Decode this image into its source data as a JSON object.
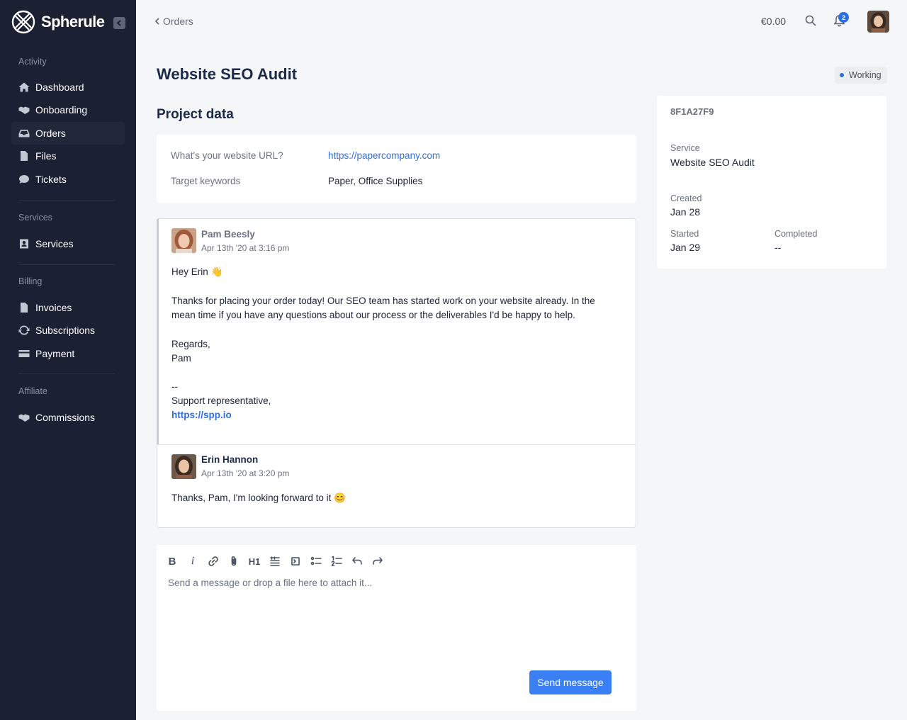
{
  "brand": {
    "name": "Spherule"
  },
  "sidebar": {
    "sections": [
      {
        "title": "Activity",
        "items": [
          {
            "label": "Dashboard",
            "icon": "home-icon"
          },
          {
            "label": "Onboarding",
            "icon": "handshake-icon"
          },
          {
            "label": "Orders",
            "icon": "inbox-icon",
            "active": true
          },
          {
            "label": "Files",
            "icon": "file-icon"
          },
          {
            "label": "Tickets",
            "icon": "chat-icon"
          }
        ]
      },
      {
        "title": "Services",
        "items": [
          {
            "label": "Services",
            "icon": "id-card-icon"
          }
        ]
      },
      {
        "title": "Billing",
        "items": [
          {
            "label": "Invoices",
            "icon": "file-icon"
          },
          {
            "label": "Subscriptions",
            "icon": "refresh-icon"
          },
          {
            "label": "Payment",
            "icon": "credit-card-icon"
          }
        ]
      },
      {
        "title": "Affiliate",
        "items": [
          {
            "label": "Commissions",
            "icon": "handshake-icon"
          }
        ]
      }
    ]
  },
  "topbar": {
    "back_label": "Orders",
    "balance": "€0.00",
    "notification_count": "2"
  },
  "page": {
    "title": "Website SEO Audit",
    "status": "Working",
    "status_color": "#2d6fe0"
  },
  "project": {
    "heading": "Project data",
    "fields": [
      {
        "label": "What's your website URL?",
        "value": "https://papercompany.com"
      },
      {
        "label": "Target keywords",
        "value": "Paper, Office Supplies"
      }
    ]
  },
  "messages": [
    {
      "author": "Pam Beesly",
      "time": "Apr 13th '20 at 3:16 pm",
      "greeting": "Hey Erin 👋",
      "body": "Thanks for placing your order today! Our SEO team has started work on your website already. In the mean time if you have any questions about our process or the deliverables I'd be happy to help.",
      "regards": "Regards,",
      "name": "Pam",
      "dashes": "--",
      "signature": "Support representative,",
      "link": "https://spp.io"
    },
    {
      "author": "Erin Hannon",
      "time": "Apr 13th '20 at 3:20 pm",
      "body": "Thanks, Pam, I'm looking forward to it 😊"
    }
  ],
  "composer": {
    "placeholder": "Send a message or drop a file here to attach it...",
    "heading_tool": "H1",
    "send_label": "Send message"
  },
  "order": {
    "id": "8F1A27F9",
    "service_label": "Service",
    "service": "Website SEO Audit",
    "created_label": "Created",
    "created": "Jan 28",
    "started_label": "Started",
    "started": "Jan 29",
    "completed_label": "Completed",
    "completed": "--"
  },
  "colors": {
    "sidebar_bg": "#1b2032",
    "accent": "#3b7ff5",
    "link": "#2d6fe0"
  }
}
